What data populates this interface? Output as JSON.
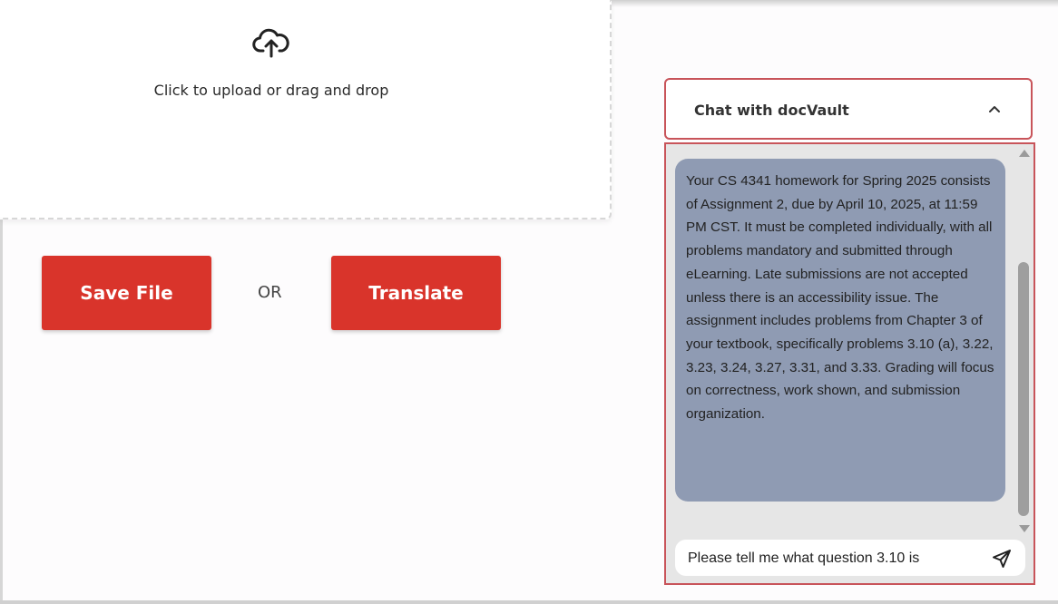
{
  "upload": {
    "icon": "cloud-upload-icon",
    "prompt": "Click to upload or drag and drop"
  },
  "actions": {
    "save_label": "Save File",
    "separator": "OR",
    "translate_label": "Translate",
    "accent_color": "#d9342b"
  },
  "chat": {
    "title": "Chat with docVault",
    "collapse_icon": "chevron-up-icon",
    "border_color": "#c8545a",
    "bubble_color": "#8f9bb3",
    "messages": [
      {
        "role": "assistant",
        "text": "Your CS 4341 homework for Spring 2025 consists of Assignment 2, due by April 10, 2025, at 11:59 PM CST. It must be completed individually, with all problems mandatory and submitted through eLearning. Late submissions are not accepted unless there is an accessibility issue. The assignment includes problems from Chapter 3 of your textbook, specifically problems 3.10 (a), 3.22, 3.23, 3.24, 3.27, 3.31, and 3.33. Grading will focus on correctness, work shown, and submission organization."
      }
    ],
    "input_value": "Please tell me what question 3.10 is",
    "send_icon": "send-icon"
  }
}
